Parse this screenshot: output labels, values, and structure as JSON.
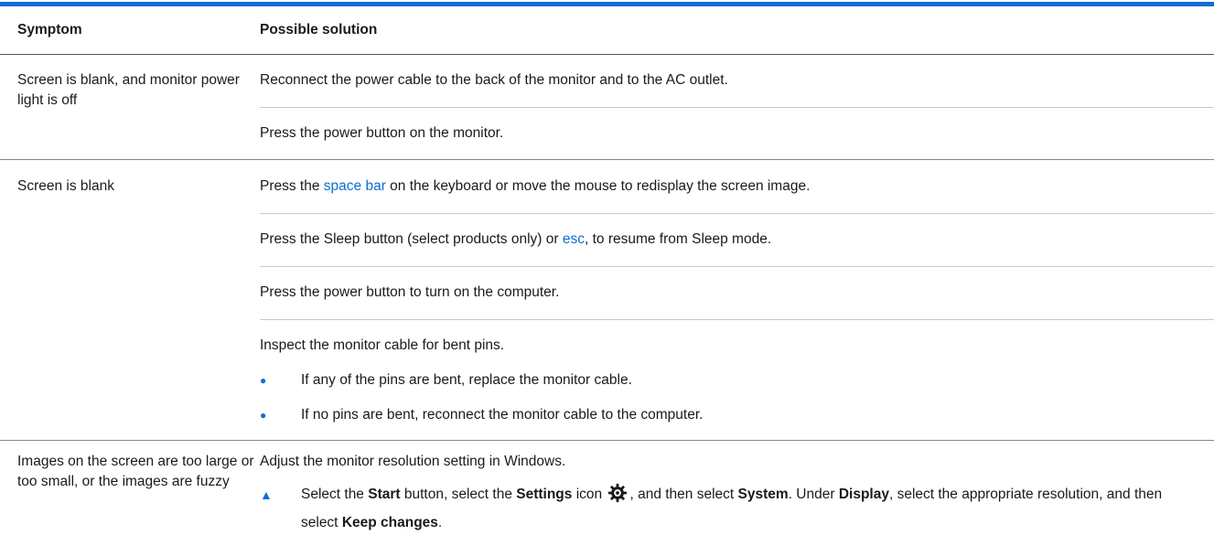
{
  "header": {
    "symptom": "Symptom",
    "solution": "Possible solution"
  },
  "rows": [
    {
      "symptom": "Screen is blank, and monitor power light is off",
      "solutions": [
        "Reconnect the power cable to the back of the monitor and to the AC outlet.",
        "Press the power button on the monitor."
      ]
    },
    {
      "symptom": "Screen is blank",
      "sol1": {
        "pre": "Press the ",
        "link": "space bar",
        "post": " on the keyboard or move the mouse to redisplay the screen image."
      },
      "sol2": {
        "pre": "Press the Sleep button (select products only) or ",
        "link": "esc",
        "post": ", to resume from Sleep mode."
      },
      "sol3": "Press the power button to turn on the computer.",
      "sol4": "Inspect the monitor cable for bent pins.",
      "bullets": [
        "If any of the pins are bent, replace the monitor cable.",
        "If no pins are bent, reconnect the monitor cable to the computer."
      ]
    },
    {
      "symptom": "Images on the screen are too large or too small, or the images are fuzzy",
      "sol1": "Adjust the monitor resolution setting in Windows.",
      "step": {
        "t1": "Select the ",
        "b1": "Start",
        "t2": " button, select the ",
        "b2": "Settings",
        "t3": " icon ",
        "t4": ", and then select ",
        "b3": "System",
        "t5": ". Under ",
        "b4": "Display",
        "t6": ", select the appropriate resolution, and then select ",
        "b5": "Keep changes",
        "t7": "."
      }
    }
  ],
  "icons": {
    "bullet": "●",
    "step_marker": "▲",
    "settings": "gear-icon"
  },
  "colors": {
    "accent": "#0a6fd6"
  }
}
